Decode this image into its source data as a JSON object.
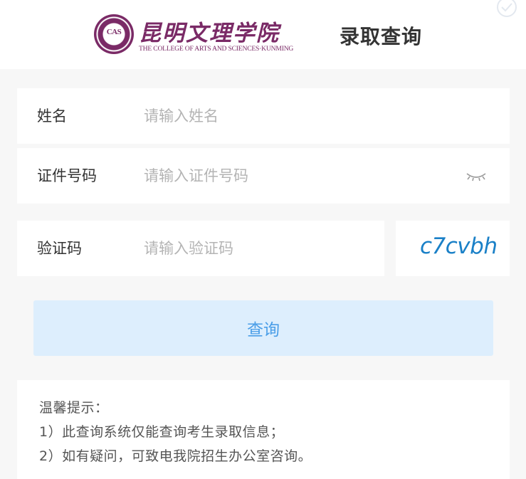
{
  "header": {
    "school_name_cn": "昆明文理学院",
    "school_name_en": "THE COLLEGE OF ARTS AND SCIENCES·KUNMING",
    "seal_text": "CAS",
    "page_title": "录取查询"
  },
  "form": {
    "name": {
      "label": "姓名",
      "placeholder": "请输入姓名",
      "value": ""
    },
    "id_number": {
      "label": "证件号码",
      "placeholder": "请输入证件号码",
      "value": ""
    },
    "captcha": {
      "label": "验证码",
      "placeholder": "请输入验证码",
      "value": "",
      "image_text": "c7cvbh"
    },
    "submit_label": "查询"
  },
  "notice": {
    "title": "温馨提示：",
    "items": [
      "1）此查询系统仅能查询考生录取信息；",
      "2）如有疑问，可致电我院招生办公室咨询。"
    ]
  },
  "colors": {
    "brand": "#7a2a66",
    "accent": "#4a9ee8",
    "button_bg": "#ddeefd",
    "captcha": "#1a80c7"
  },
  "icons": {
    "eye_toggle": "eye-closed-icon",
    "corner": "verified-badge-icon"
  }
}
